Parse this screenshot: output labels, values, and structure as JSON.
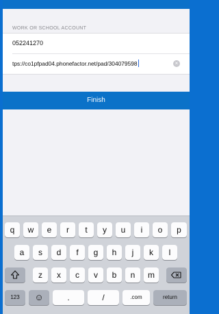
{
  "form": {
    "section_label": "WORK OR SCHOOL ACCOUNT",
    "account_value": "052241270",
    "url_value": "tps://co1pfpad04.phonefactor.net/pad/304079598",
    "clear_symbol": "×"
  },
  "finish_label": "Finish",
  "keyboard": {
    "row1": [
      "q",
      "w",
      "e",
      "r",
      "t",
      "y",
      "u",
      "i",
      "o",
      "p"
    ],
    "row2": [
      "a",
      "s",
      "d",
      "f",
      "g",
      "h",
      "j",
      "k",
      "l"
    ],
    "row3": [
      "z",
      "x",
      "c",
      "v",
      "b",
      "n",
      "m"
    ],
    "numbers_label": "123",
    "emoji_label": "☺",
    "dot_label": ".",
    "slash_label": "/",
    "com_label": ".com",
    "return_label": "return"
  },
  "colors": {
    "accent": "#0b72c8",
    "background": "#f2f2f6",
    "keyboard": "#d0d3d9"
  }
}
